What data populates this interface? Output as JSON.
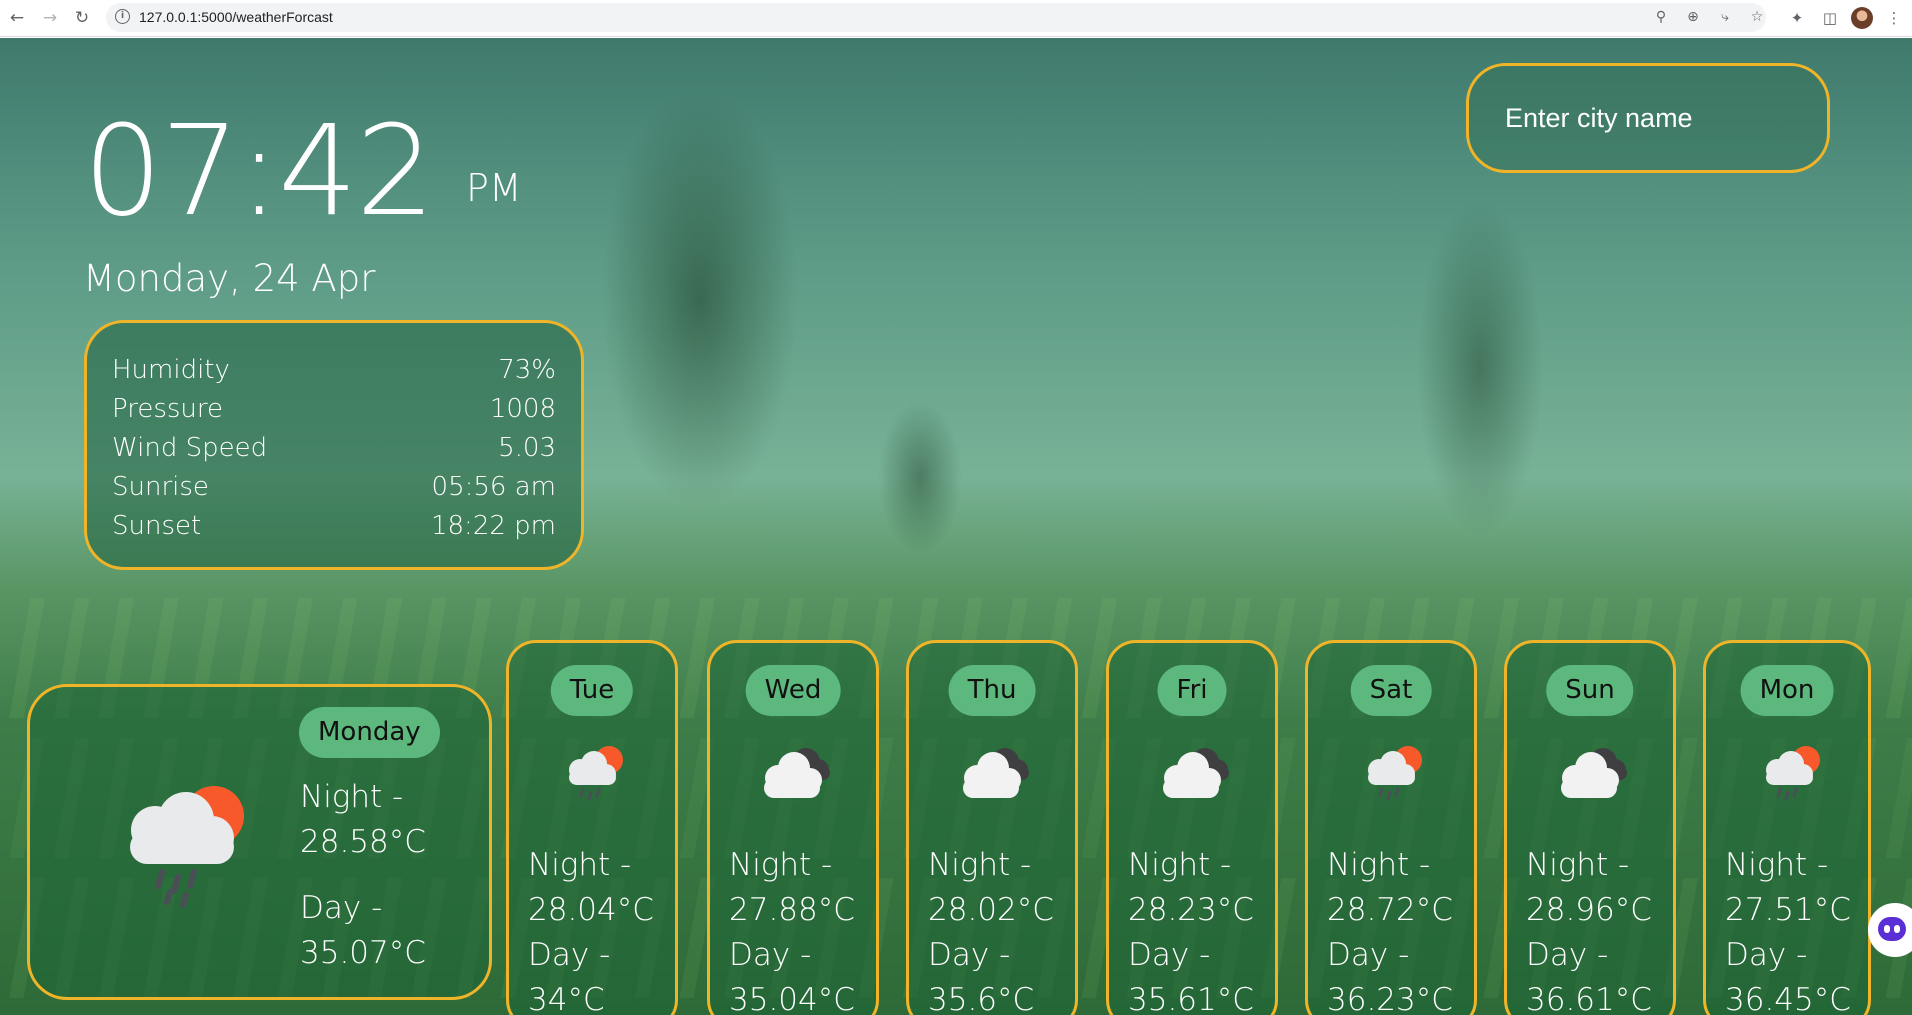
{
  "browser": {
    "url": "127.0.0.1:5000/weatherForcast"
  },
  "clock": {
    "time": "07:42",
    "ampm": "PM"
  },
  "date": "Monday, 24 Apr",
  "search": {
    "placeholder": "Enter city name",
    "value": ""
  },
  "details": [
    {
      "label": "Humidity",
      "value": "73%"
    },
    {
      "label": "Pressure",
      "value": "1008"
    },
    {
      "label": "Wind Speed",
      "value": "5.03"
    },
    {
      "label": "Sunrise",
      "value": "05:56 am"
    },
    {
      "label": "Sunset",
      "value": "18:22 pm"
    }
  ],
  "today": {
    "day": "Monday",
    "night_line1": "Night -",
    "night_line2": "28.58°C",
    "day_line1": "Day -",
    "day_line2": "35.07°C",
    "icon": "rain-sun-cloud-icon"
  },
  "forecast": [
    {
      "day": "Tue",
      "icon": "rain-sun-cloud-icon",
      "night": "28.04°C",
      "dayt": "34°C"
    },
    {
      "day": "Wed",
      "icon": "cloudy-icon",
      "night": "27.88°C",
      "dayt": "35.04°C"
    },
    {
      "day": "Thu",
      "icon": "cloudy-icon",
      "night": "28.02°C",
      "dayt": "35.6°C"
    },
    {
      "day": "Fri",
      "icon": "cloudy-icon",
      "night": "28.23°C",
      "dayt": "35.61°C"
    },
    {
      "day": "Sat",
      "icon": "rain-sun-cloud-icon",
      "night": "28.72°C",
      "dayt": "36.23°C"
    },
    {
      "day": "Sun",
      "icon": "cloudy-icon",
      "night": "28.96°C",
      "dayt": "36.61°C"
    },
    {
      "day": "Mon",
      "icon": "rain-sun-cloud-icon",
      "night": "27.51°C",
      "dayt": "36.45°C"
    }
  ],
  "labels": {
    "night": "Night -",
    "day": "Day -"
  },
  "colors": {
    "accent_border": "#f0b429",
    "pill": "#5cb87c",
    "sun": "#f7592a"
  }
}
